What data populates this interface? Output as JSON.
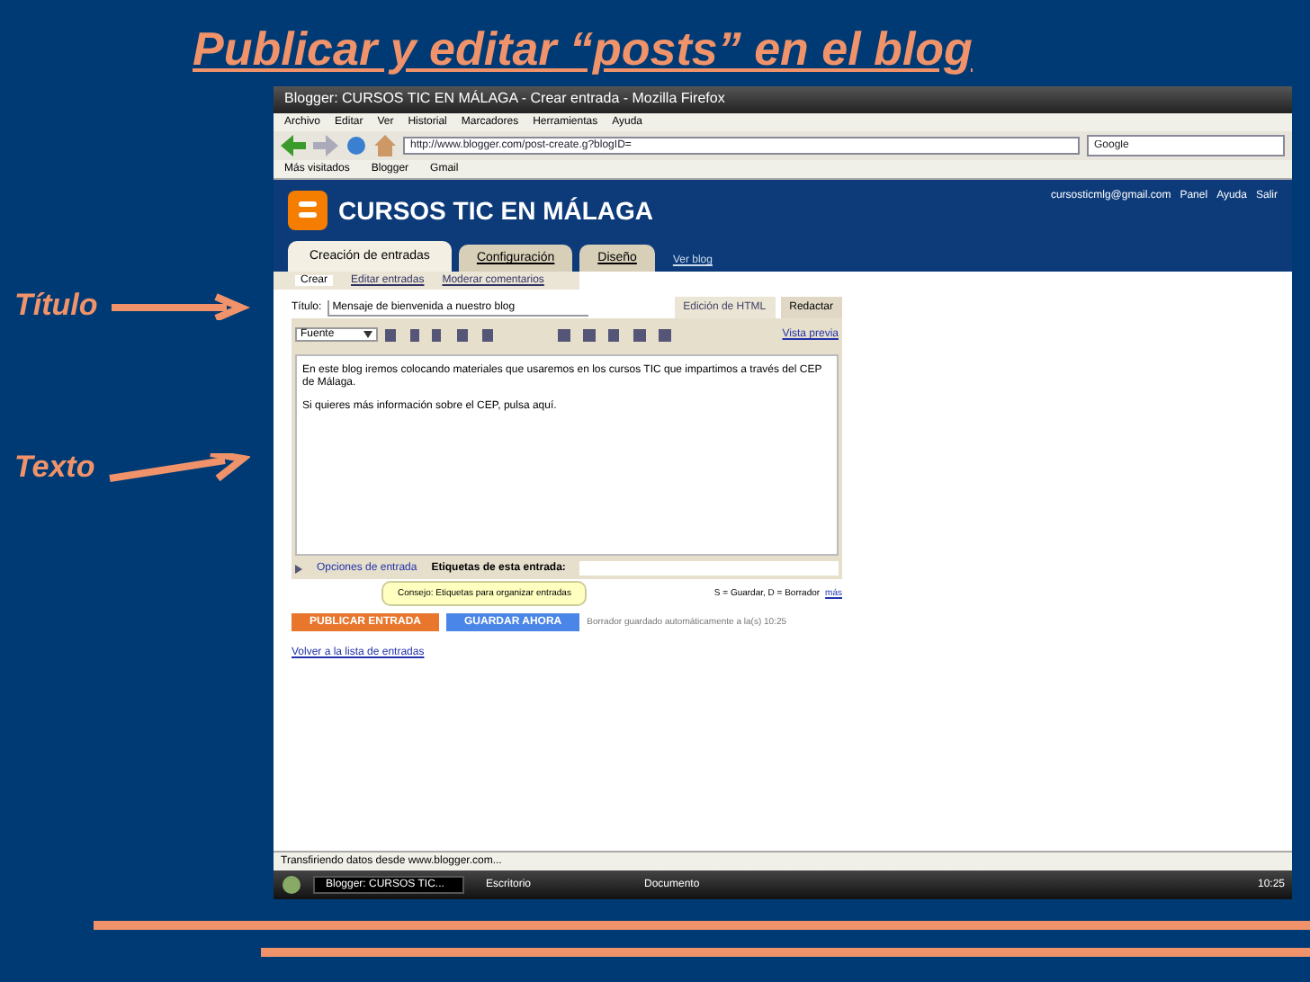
{
  "slide": {
    "title": "Publicar y editar “posts” en el blog"
  },
  "callouts": [
    {
      "label": "Título"
    },
    {
      "label": "Texto"
    }
  ],
  "browser": {
    "title": "Blogger: CURSOS TIC EN MÁLAGA - Crear entrada - Mozilla Firefox",
    "menu": [
      "Archivo",
      "Editar",
      "Ver",
      "Historial",
      "Marcadores",
      "Herramientas",
      "Ayuda"
    ],
    "address": "http://www.blogger.com/post-create.g?blogID=",
    "search_placeholder": "Google",
    "bookmarks": [
      "Más visitados",
      "Blogger",
      "Gmail"
    ]
  },
  "blog": {
    "name": "CURSOS TIC EN MÁLAGA",
    "user_links": [
      "cursosticmlg@gmail.com",
      "Panel",
      "Ayuda",
      "Salir"
    ],
    "tabs": [
      {
        "label": "Creación de entradas",
        "selected": true
      },
      {
        "label": "Configuración",
        "selected": false
      },
      {
        "label": "Diseño",
        "selected": false
      }
    ],
    "view_blog": "Ver blog",
    "subtabs": [
      {
        "label": "Crear",
        "selected": true
      },
      {
        "label": "Editar entradas",
        "selected": false
      },
      {
        "label": "Moderar comentarios",
        "selected": false
      }
    ],
    "title_label": "Título:",
    "title_value": "Mensaje de bienvenida a nuestro blog",
    "mode_buttons": [
      {
        "label": "Edición de HTML",
        "selected": false
      },
      {
        "label": "Redactar",
        "selected": true
      }
    ],
    "font_select": "Fuente",
    "preview": "Vista previa",
    "body": [
      "En este blog iremos colocando materiales que usaremos en los cursos TIC que impartimos a través del CEP de Málaga.",
      "Si quieres más información sobre el CEP, pulsa aquí."
    ],
    "options": "Opciones de entrada",
    "labels_title": "Etiquetas de esta entrada:",
    "tooltip": "Consejo: Etiquetas para organizar entradas",
    "shortcuts": "S = Guardar, D = Borrador",
    "shortcuts_link": "más",
    "publish": "PUBLICAR ENTRADA",
    "save": "GUARDAR AHORA",
    "saved_note": "Borrador guardado automáticamente a la(s) 10:25",
    "back": "Volver a la lista de entradas"
  },
  "status_bar": "Transfiriendo datos desde www.blogger.com...",
  "taskbar": {
    "items": [
      {
        "label": "Blogger: CURSOS TIC...",
        "selected": true
      },
      {
        "label": "Escritorio",
        "selected": false
      },
      {
        "label": "Documento",
        "selected": false
      }
    ],
    "clock": "10:25"
  }
}
